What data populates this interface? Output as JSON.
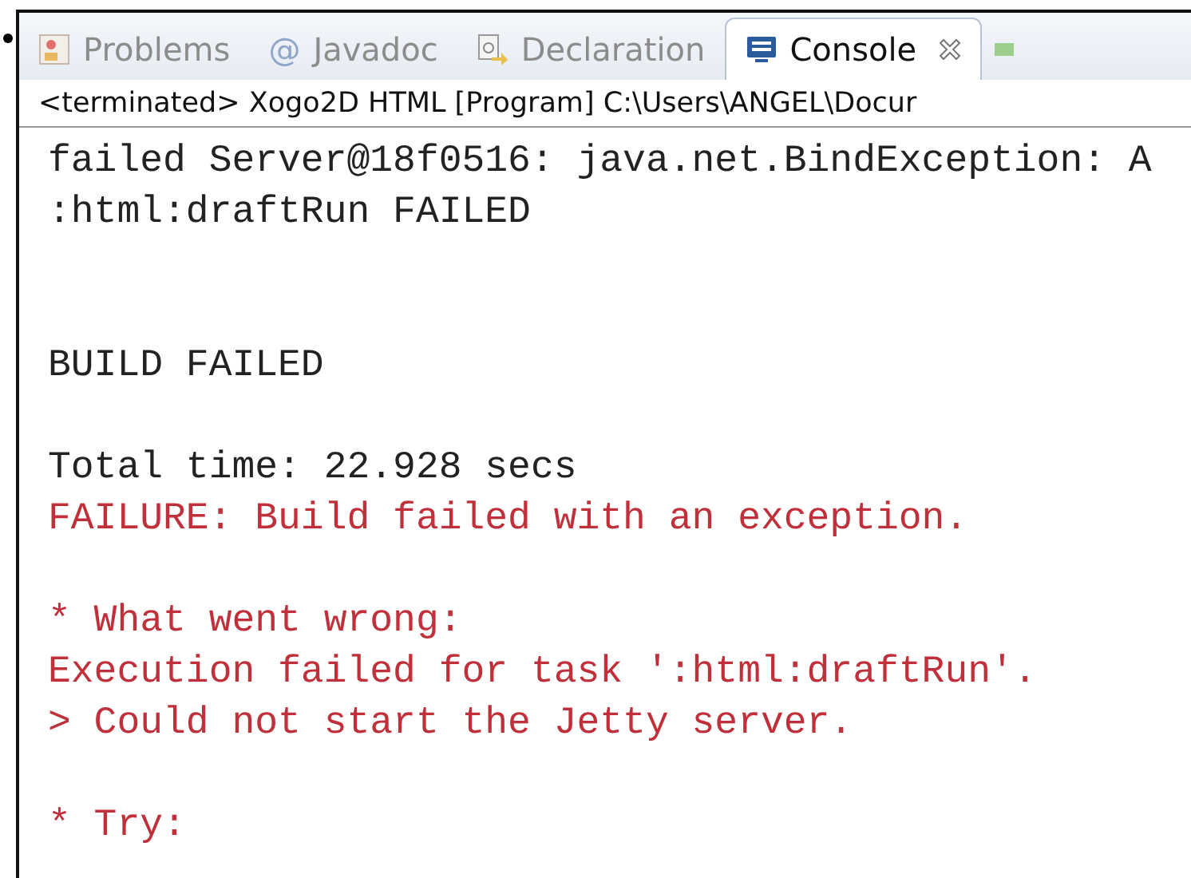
{
  "tabs": [
    {
      "label": "Problems",
      "kind": "problems",
      "selected": false
    },
    {
      "label": "Javadoc",
      "kind": "glyph",
      "glyph": "@",
      "selected": false
    },
    {
      "label": "Declaration",
      "kind": "declaration",
      "selected": false
    },
    {
      "label": "Console",
      "kind": "console",
      "selected": true
    }
  ],
  "console": {
    "status": "<terminated> Xogo2D HTML [Program] C:\\Users\\ANGEL\\Docur",
    "lines": [
      {
        "kind": "out",
        "text": "failed Server@18f0516: java.net.BindException: A"
      },
      {
        "kind": "out",
        "text": ":html:draftRun FAILED"
      },
      {
        "kind": "blank"
      },
      {
        "kind": "blank"
      },
      {
        "kind": "out",
        "text": "BUILD FAILED"
      },
      {
        "kind": "blank"
      },
      {
        "kind": "out",
        "text": "Total time: 22.928 secs"
      },
      {
        "kind": "err",
        "text": "FAILURE: Build failed with an exception."
      },
      {
        "kind": "blank"
      },
      {
        "kind": "err",
        "text": "* What went wrong:"
      },
      {
        "kind": "err",
        "text": "Execution failed for task ':html:draftRun'."
      },
      {
        "kind": "err",
        "text": "> Could not start the Jetty server."
      },
      {
        "kind": "blank"
      },
      {
        "kind": "err",
        "text": "* Try:"
      }
    ]
  }
}
